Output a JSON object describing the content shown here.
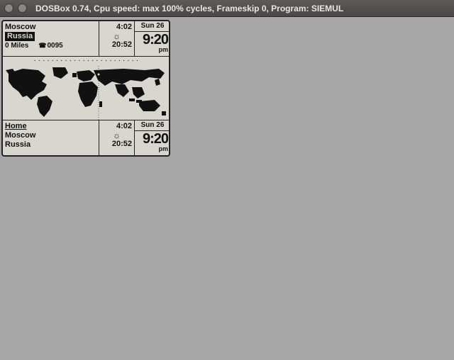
{
  "window": {
    "title": "DOSBox 0.74, Cpu speed: max 100% cycles, Frameskip  0, Program:   SIEMUL"
  },
  "worldclock": {
    "top": {
      "city": "Moscow",
      "country": "Russia",
      "distance": "0 Miles",
      "dial_prefix": "0095",
      "sunrise": "4:02",
      "sunset": "20:52",
      "day": "Sun 26",
      "time": "9:20",
      "ampm": "pm"
    },
    "bottom": {
      "label": "Home",
      "city": "Moscow",
      "country": "Russia",
      "sunrise": "4:02",
      "sunset": "20:52",
      "day": "Sun 26",
      "time": "9:20",
      "ampm": "pm"
    }
  }
}
